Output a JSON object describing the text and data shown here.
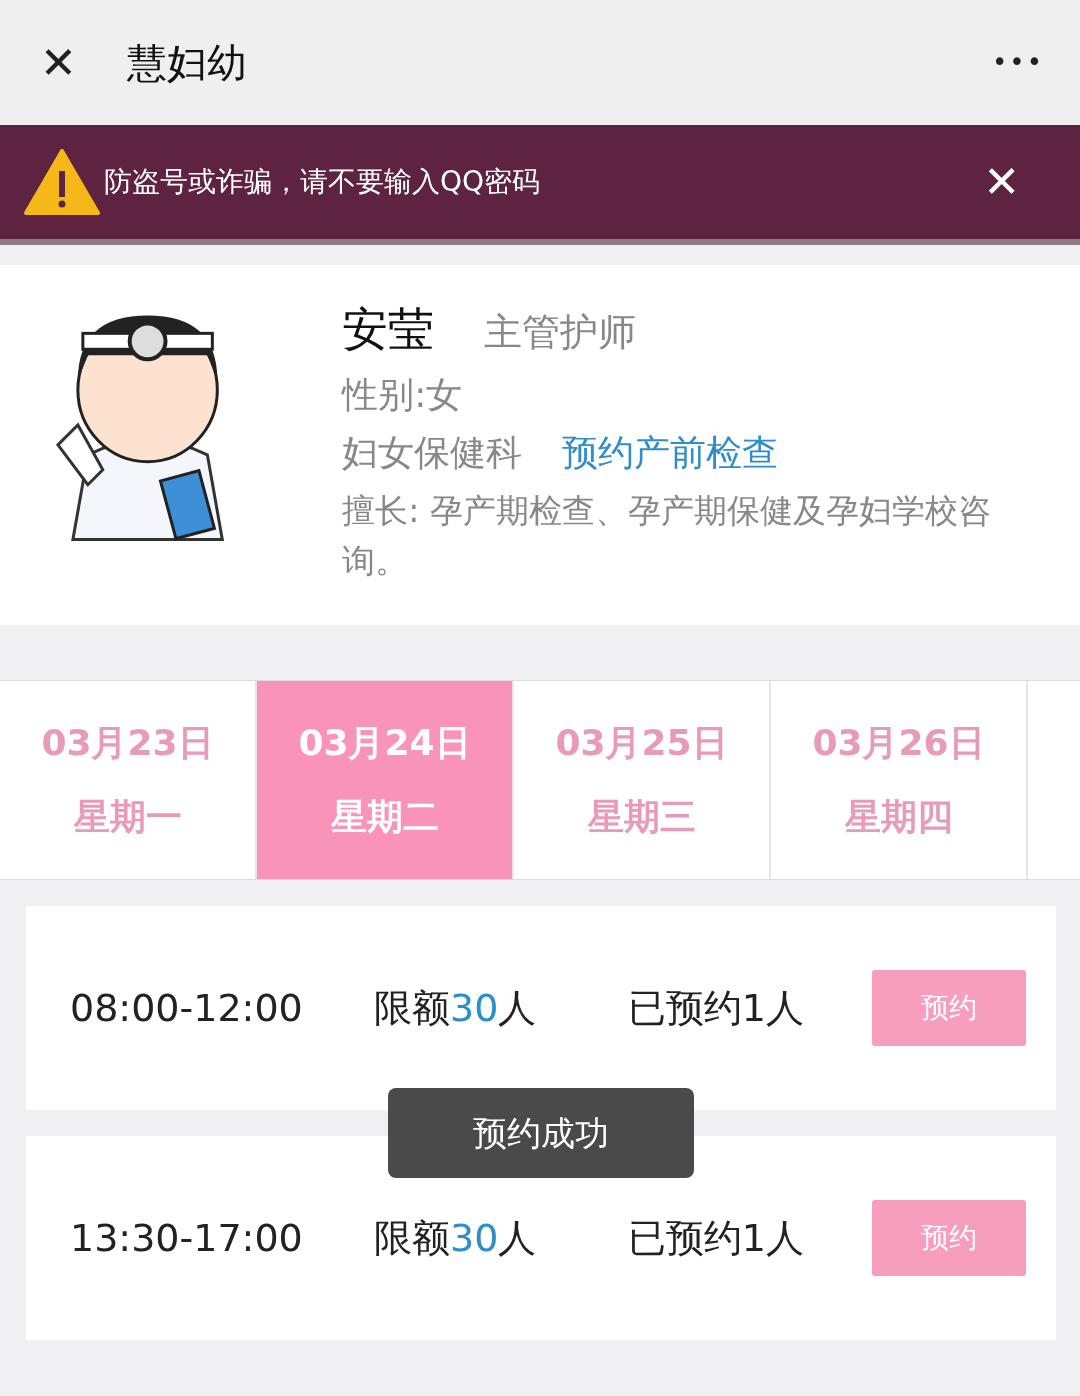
{
  "header": {
    "close": "✕",
    "title": "慧妇幼",
    "more": "•••"
  },
  "warning": {
    "text": "防盗号或诈骗，请不要输入QQ密码",
    "close": "✕"
  },
  "doctor": {
    "name": "安莹",
    "title": "主管护师",
    "gender": "性别:女",
    "department": "妇女保健科",
    "link": "预约产前检查",
    "specialty": "擅长: 孕产期检查、孕产期保健及孕妇学校咨询。"
  },
  "dates": [
    {
      "date": "03月23日",
      "weekday": "星期一",
      "selected": false
    },
    {
      "date": "03月24日",
      "weekday": "星期二",
      "selected": true
    },
    {
      "date": "03月25日",
      "weekday": "星期三",
      "selected": false
    },
    {
      "date": "03月26日",
      "weekday": "星期四",
      "selected": false
    }
  ],
  "slots": [
    {
      "time": "08:00-12:00",
      "quota_label": "限额",
      "quota": "30",
      "quota_unit": "人",
      "booked": "已预约1人",
      "button": "预约"
    },
    {
      "time": "13:30-17:00",
      "quota_label": "限额",
      "quota": "30",
      "quota_unit": "人",
      "booked": "已预约1人",
      "button": "预约"
    }
  ],
  "toast": "预约成功"
}
